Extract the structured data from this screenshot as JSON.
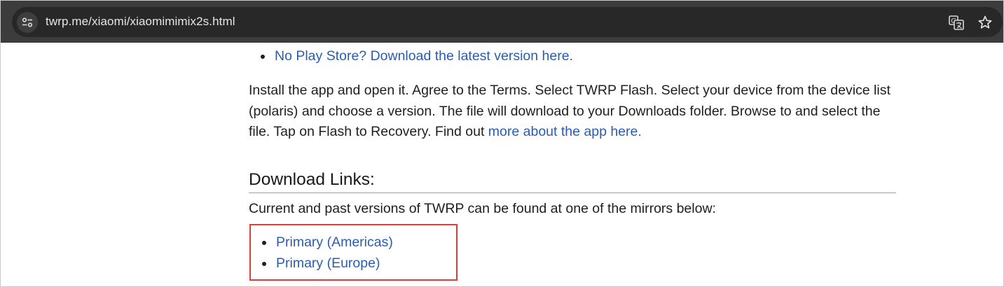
{
  "browser": {
    "url": "twrp.me/xiaomi/xiaomimimix2s.html",
    "icons": {
      "site_info": "tune-icon",
      "translate": "translate-icon",
      "bookmark": "star-icon"
    }
  },
  "page": {
    "top_list": [
      {
        "label": "No Play Store? Download the latest version here."
      }
    ],
    "install_text": "Install the app and open it. Agree to the Terms. Select TWRP Flash. Select your device from the device list (polaris) and choose a version. The file will download to your Downloads folder. Browse to and select the file. Tap on Flash to Recovery. Find out ",
    "install_link": "more about the app here.",
    "download_heading": "Download Links:",
    "download_sub": "Current and past versions of TWRP can be found at one of the mirrors below:",
    "mirrors": [
      {
        "label": "Primary (Americas)"
      },
      {
        "label": "Primary (Europe)"
      }
    ],
    "colors": {
      "link": "#2a5db0",
      "highlight_box": "#e03c3c",
      "toolbar": "#3c3c3c"
    }
  }
}
